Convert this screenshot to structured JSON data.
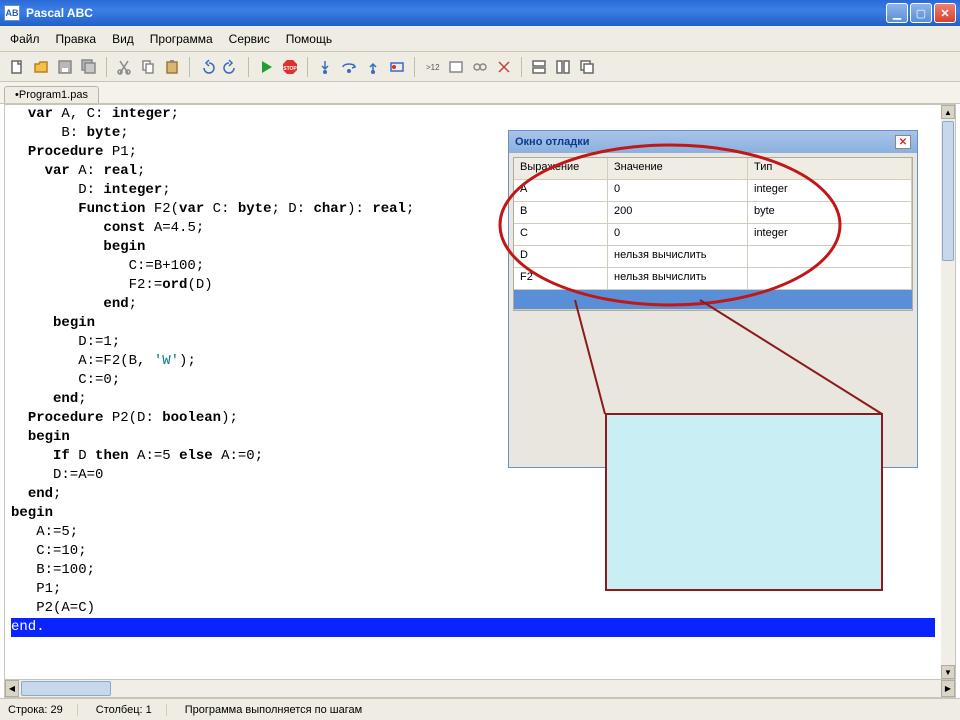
{
  "window": {
    "title": "Pascal ABC"
  },
  "menu": {
    "file": "Файл",
    "edit": "Правка",
    "view": "Вид",
    "program": "Программа",
    "service": "Сервис",
    "help": "Помощь"
  },
  "tabs": {
    "file1": "•Program1.pas"
  },
  "code_lines": [
    "  var A, C: integer;",
    "      B: byte;",
    "  Procedure P1;",
    "    var A: real;",
    "        D: integer;",
    "        Function F2(var C: byte; D: char): real;",
    "           const A=4.5;",
    "           begin",
    "              C:=B+100;",
    "              F2:=ord(D)",
    "           end;",
    "     begin",
    "        D:=1;",
    "        A:=F2(B, 'W');",
    "        C:=0;",
    "     end;",
    "  Procedure P2(D: boolean);",
    "  begin",
    "     If D then A:=5 else A:=0;",
    "     D:=A=0",
    "  end;",
    "begin",
    "   A:=5;",
    "   C:=10;",
    "   B:=100;",
    "   P1;",
    "   P2(A=C)",
    "end."
  ],
  "highlight_index": 27,
  "debug_window": {
    "title": "Окно отладки",
    "columns": {
      "expr": "Выражение",
      "value": "Значение",
      "type": "Тип"
    },
    "rows": [
      {
        "expr": "A",
        "value": "0",
        "type": "integer"
      },
      {
        "expr": "B",
        "value": "200",
        "type": "byte"
      },
      {
        "expr": "C",
        "value": "0",
        "type": "integer"
      },
      {
        "expr": "D",
        "value": "нельзя вычислить",
        "type": ""
      },
      {
        "expr": "F2",
        "value": "нельзя вычислить",
        "type": ""
      }
    ]
  },
  "status": {
    "line_label": "Строка: 29",
    "col_label": "Столбец: 1",
    "message": "Программа выполняется по шагам"
  }
}
